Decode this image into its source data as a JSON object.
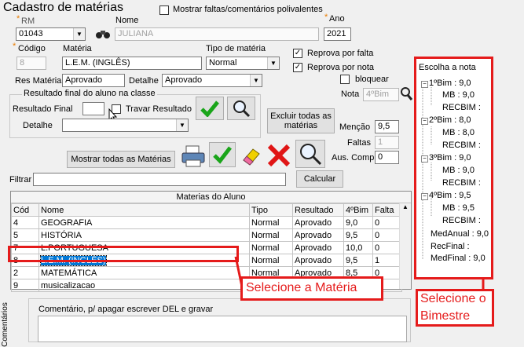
{
  "window": {
    "title": "Cadastro de matérias",
    "show_faltas_label": "Mostrar faltas/comentários polivalentes"
  },
  "header": {
    "rm_label": "RM",
    "rm_value": "01043",
    "nome_label": "Nome",
    "nome_value": "JULIANA",
    "ano_label": "Ano",
    "ano_value": "2021"
  },
  "materia": {
    "codigo_label": "Código",
    "codigo_value": "8",
    "materia_label": "Matéria",
    "materia_value": "L.E.M. (INGLÊS)",
    "tipo_label": "Tipo de matéria",
    "tipo_value": "Normal",
    "reprova_falta": "Reprova por falta",
    "reprova_nota": "Reprova por nota",
    "bloquear": "bloquear",
    "nota_label": "Nota",
    "nota_value": "4ºBim",
    "res_materia_label": "Res Matéria",
    "res_materia_value": "Aprovado",
    "detalhe_label": "Detalhe",
    "detalhe_value": "Aprovado"
  },
  "resultado_final": {
    "group_label": "Resultado final do aluno na classe",
    "resultado_label": "Resultado Final",
    "travar_label": "Travar Resultado",
    "detalhe_label": "Detalhe",
    "excluir_button": "Excluir todas as matérias"
  },
  "side": {
    "mencao_label": "Menção",
    "mencao_value": "9,5",
    "faltas_label": "Faltas",
    "faltas_value": "1",
    "aus_label": "Aus. Comp",
    "aus_value": "0"
  },
  "toolbar": {
    "mostrar_button": "Mostrar todas as Matérias",
    "calcular_button": "Calcular",
    "filtrar_label": "Filtrar"
  },
  "table": {
    "caption": "Materias do Aluno",
    "columns": [
      "Cód",
      "Nome",
      "Tipo",
      "Resultado",
      "4ºBim",
      "Falta"
    ],
    "rows": [
      [
        "4",
        "GEOGRAFIA",
        "Normal",
        "Aprovado",
        "9,0",
        "0"
      ],
      [
        "5",
        "HISTÓRIA",
        "Normal",
        "Aprovado",
        "9,5",
        "0"
      ],
      [
        "7",
        "L.PORTUGUESA",
        "Normal",
        "Aprovado",
        "10,0",
        "0"
      ],
      [
        "8",
        "L.E.M. (INGLÊS)",
        "Normal",
        "Aprovado",
        "9,5",
        "1"
      ],
      [
        "2",
        "MATEMÁTICA",
        "Normal",
        "Aprovado",
        "8,5",
        "0"
      ],
      [
        "9",
        "musicalizacao",
        "",
        "",
        "",
        ""
      ]
    ]
  },
  "comment": {
    "label": "Comentário, p/ apagar escrever DEL e gravar",
    "side_label": "Comentários"
  },
  "tree": {
    "title": "Escolha a nota",
    "items": [
      "1ºBim : 9,0",
      "MB : 9,0",
      "RECBIM :",
      "2ºBim : 8,0",
      "MB : 8,0",
      "RECBIM :",
      "3ºBim : 9,0",
      "MB : 9,0",
      "RECBIM :",
      "4ºBim : 9,5",
      "MB : 9,5",
      "RECBIM :",
      "MedAnual : 9,0",
      "RecFinal :",
      "MedFinal : 9,0"
    ]
  },
  "annotations": {
    "materia_note": "Selecione a Matéria",
    "bimestre_note_1": "Selecione o",
    "bimestre_note_2": "Bimestre"
  },
  "colors": {
    "annotation_red": "#e51b1b",
    "selection_blue": "#0078d7"
  }
}
